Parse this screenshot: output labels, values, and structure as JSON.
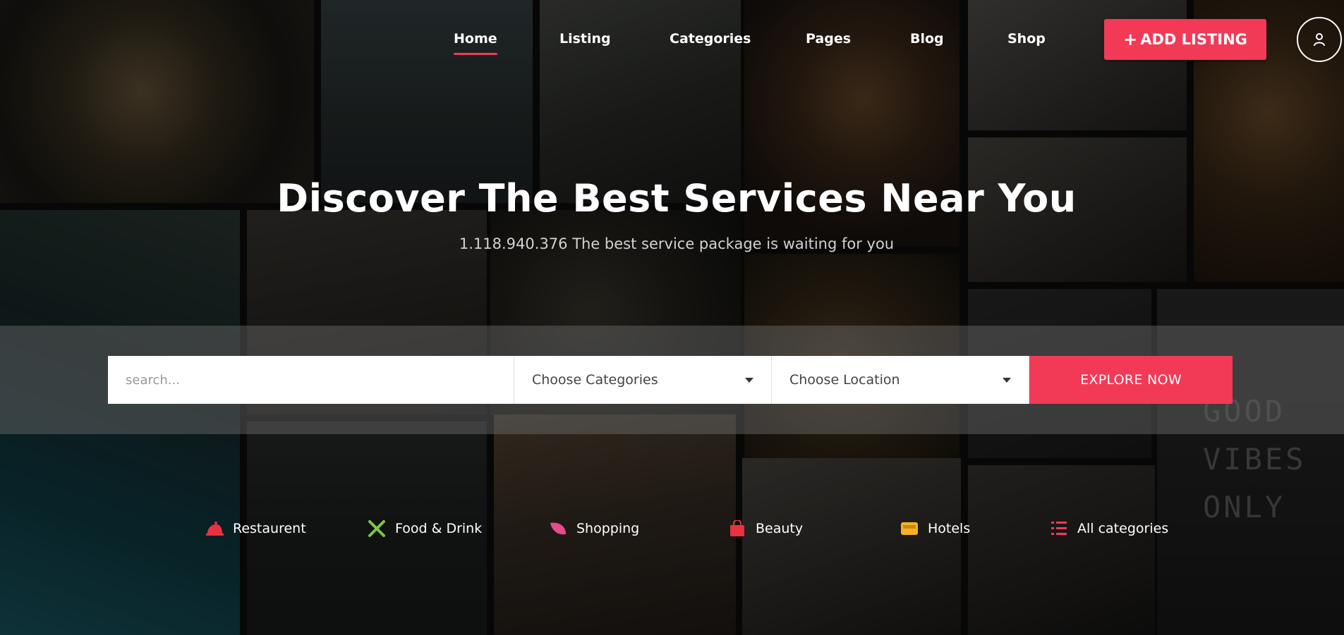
{
  "nav": {
    "items": [
      {
        "label": "Home",
        "active": true
      },
      {
        "label": "Listing"
      },
      {
        "label": "Categories"
      },
      {
        "label": "Pages"
      },
      {
        "label": "Blog"
      },
      {
        "label": "Shop"
      }
    ],
    "add_listing_label": "ADD LISTING",
    "add_listing_plus": "+",
    "user_icon": "user-icon"
  },
  "hero": {
    "title": "Discover The Best Services Near You",
    "subtitle": "1.118.940.376 The best service package is waiting for you"
  },
  "search": {
    "placeholder": "search...",
    "category_select": "Choose Categories",
    "location_select": "Choose Location",
    "submit_label": "EXPLORE NOW"
  },
  "categories": [
    {
      "label": "Restaurent",
      "icon": "bell-icon",
      "color": "#f23a57"
    },
    {
      "label": "Food & Drink",
      "icon": "fork-knife-icon",
      "color": "#7ac943"
    },
    {
      "label": "Shopping",
      "icon": "leaf-icon",
      "color": "#e84a8f"
    },
    {
      "label": "Beauty",
      "icon": "bag-icon",
      "color": "#e8323f"
    },
    {
      "label": "Hotels",
      "icon": "bed-icon",
      "color": "#f5b324"
    },
    {
      "label": "All categories",
      "icon": "list-icon",
      "color": "#f23a57"
    }
  ],
  "background": {
    "sign_text": "GOOD VIBES ONLY"
  },
  "colors": {
    "accent": "#f23a57",
    "overlay": "rgba(0,0,0,0.45)"
  }
}
